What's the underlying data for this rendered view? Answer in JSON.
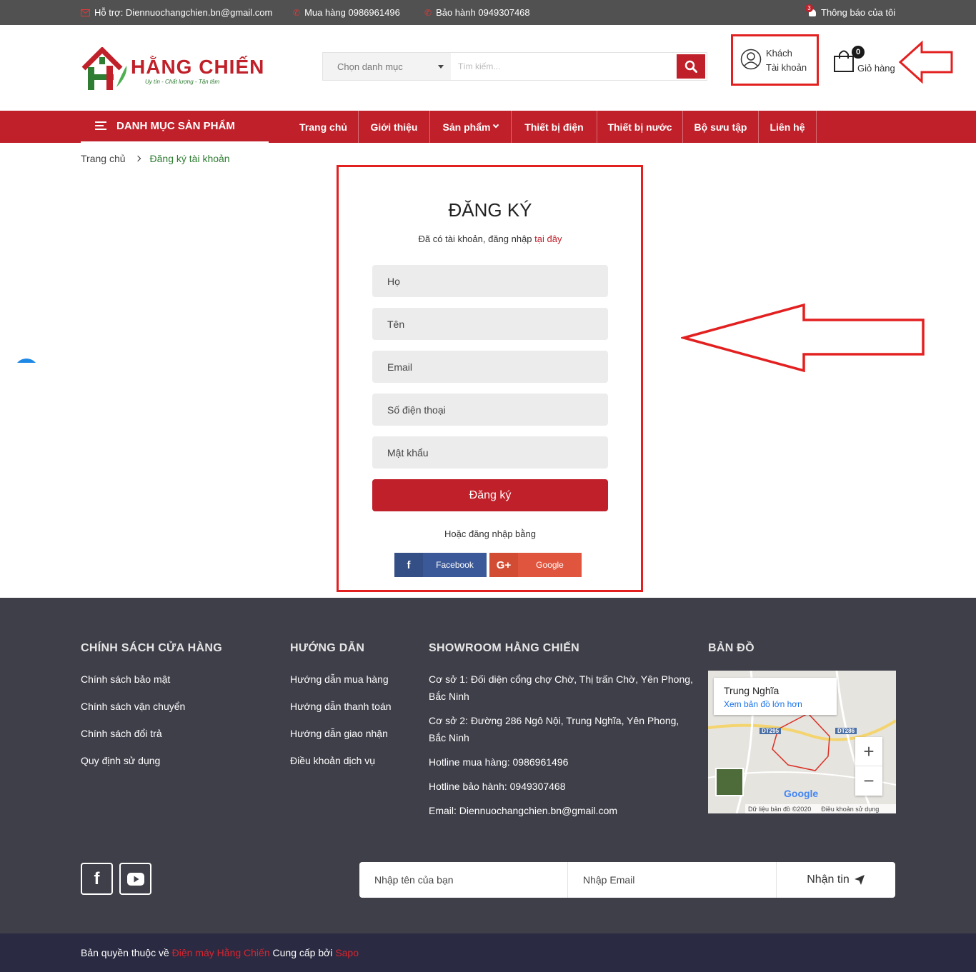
{
  "topbar": {
    "support": "Hỗ trợ: Diennuochangchien.bn@gmail.com",
    "buy_phone": "Mua hàng 0986961496",
    "warranty_phone": "Bảo hành 0949307468",
    "notification_count": "3",
    "notifications": "Thông báo của tôi"
  },
  "logo": {
    "name": "HẰNG CHIẾN",
    "slogan": "Uy tín - Chất lượng - Tận tâm"
  },
  "search": {
    "category": "Chọn danh mục",
    "placeholder": "Tìm kiếm..."
  },
  "account": {
    "line1": "Khách",
    "line2": "Tài khoản"
  },
  "cart": {
    "count": "0",
    "label": "Giỏ hàng"
  },
  "nav": {
    "category_menu": "DANH MỤC SẢN PHẨM",
    "links": [
      "Trang chủ",
      "Giới thiệu",
      "Sản phẩm",
      "Thiết bị điện",
      "Thiết bị nước",
      "Bộ sưu tập",
      "Liên hệ"
    ]
  },
  "breadcrumb": {
    "home": "Trang chủ",
    "current": "Đăng ký tài khoản"
  },
  "form": {
    "title": "ĐĂNG KÝ",
    "subtitle": "Đã có tài khoản, đăng nhập ",
    "login_link": "tại đây",
    "fields": {
      "last_name": "Họ",
      "first_name": "Tên",
      "email": "Email",
      "phone": "Số điện thoại",
      "password": "Mật khẩu"
    },
    "submit": "Đăng ký",
    "or_login": "Hoặc đăng nhập bằng",
    "facebook": "Facebook",
    "google": "Google"
  },
  "footer": {
    "policy": {
      "title": "CHÍNH SÁCH CỬA HÀNG",
      "links": [
        "Chính sách bảo mật",
        "Chính sách vận chuyển",
        "Chính sách đổi trả",
        "Quy định sử dụng"
      ]
    },
    "guide": {
      "title": "HƯỚNG DẪN",
      "links": [
        "Hướng dẫn mua hàng",
        "Hướng dẫn thanh toán",
        "Hướng dẫn giao nhận",
        "Điều khoản dịch vụ"
      ]
    },
    "showroom": {
      "title": "SHOWROOM HẰNG CHIẾN",
      "address1": "Cơ sở 1: Đối diện cổng chợ Chờ, Thị trấn Chờ, Yên Phong, Bắc Ninh",
      "address2": "Cơ sở 2: Đường 286 Ngô Nội, Trung Nghĩa, Yên Phong, Bắc Ninh",
      "hotline_buy": "Hotline mua hàng: 0986961496",
      "hotline_warranty": "Hotline bảo hành: 0949307468",
      "email": "Email: Diennuochangchien.bn@gmail.com"
    },
    "map": {
      "title": "BẢN ĐỒ",
      "place": "Trung Nghĩa",
      "larger_map": "Xem bản đồ lớn hơn",
      "road1": "DT295",
      "road2": "DT286",
      "google": "Google",
      "data": "Dữ liệu bản đồ ©2020",
      "terms": "Điều khoản sử dụng"
    },
    "newsletter": {
      "name_placeholder": "Nhập tên của bạn",
      "email_placeholder": "Nhập Email",
      "submit": "Nhận tin"
    }
  },
  "copyright": {
    "prefix": "Bản quyền thuộc về ",
    "company": "Điện máy Hằng Chiến",
    "middle": " Cung cấp bởi ",
    "provider": "Sapo"
  },
  "colors": {
    "brand_red": "#c0202a",
    "annotation_red": "#e32020",
    "footer_bg": "#3f3f4a",
    "copyright_bg": "#2a2a42",
    "facebook": "#3b5998",
    "google": "#e0553d"
  }
}
